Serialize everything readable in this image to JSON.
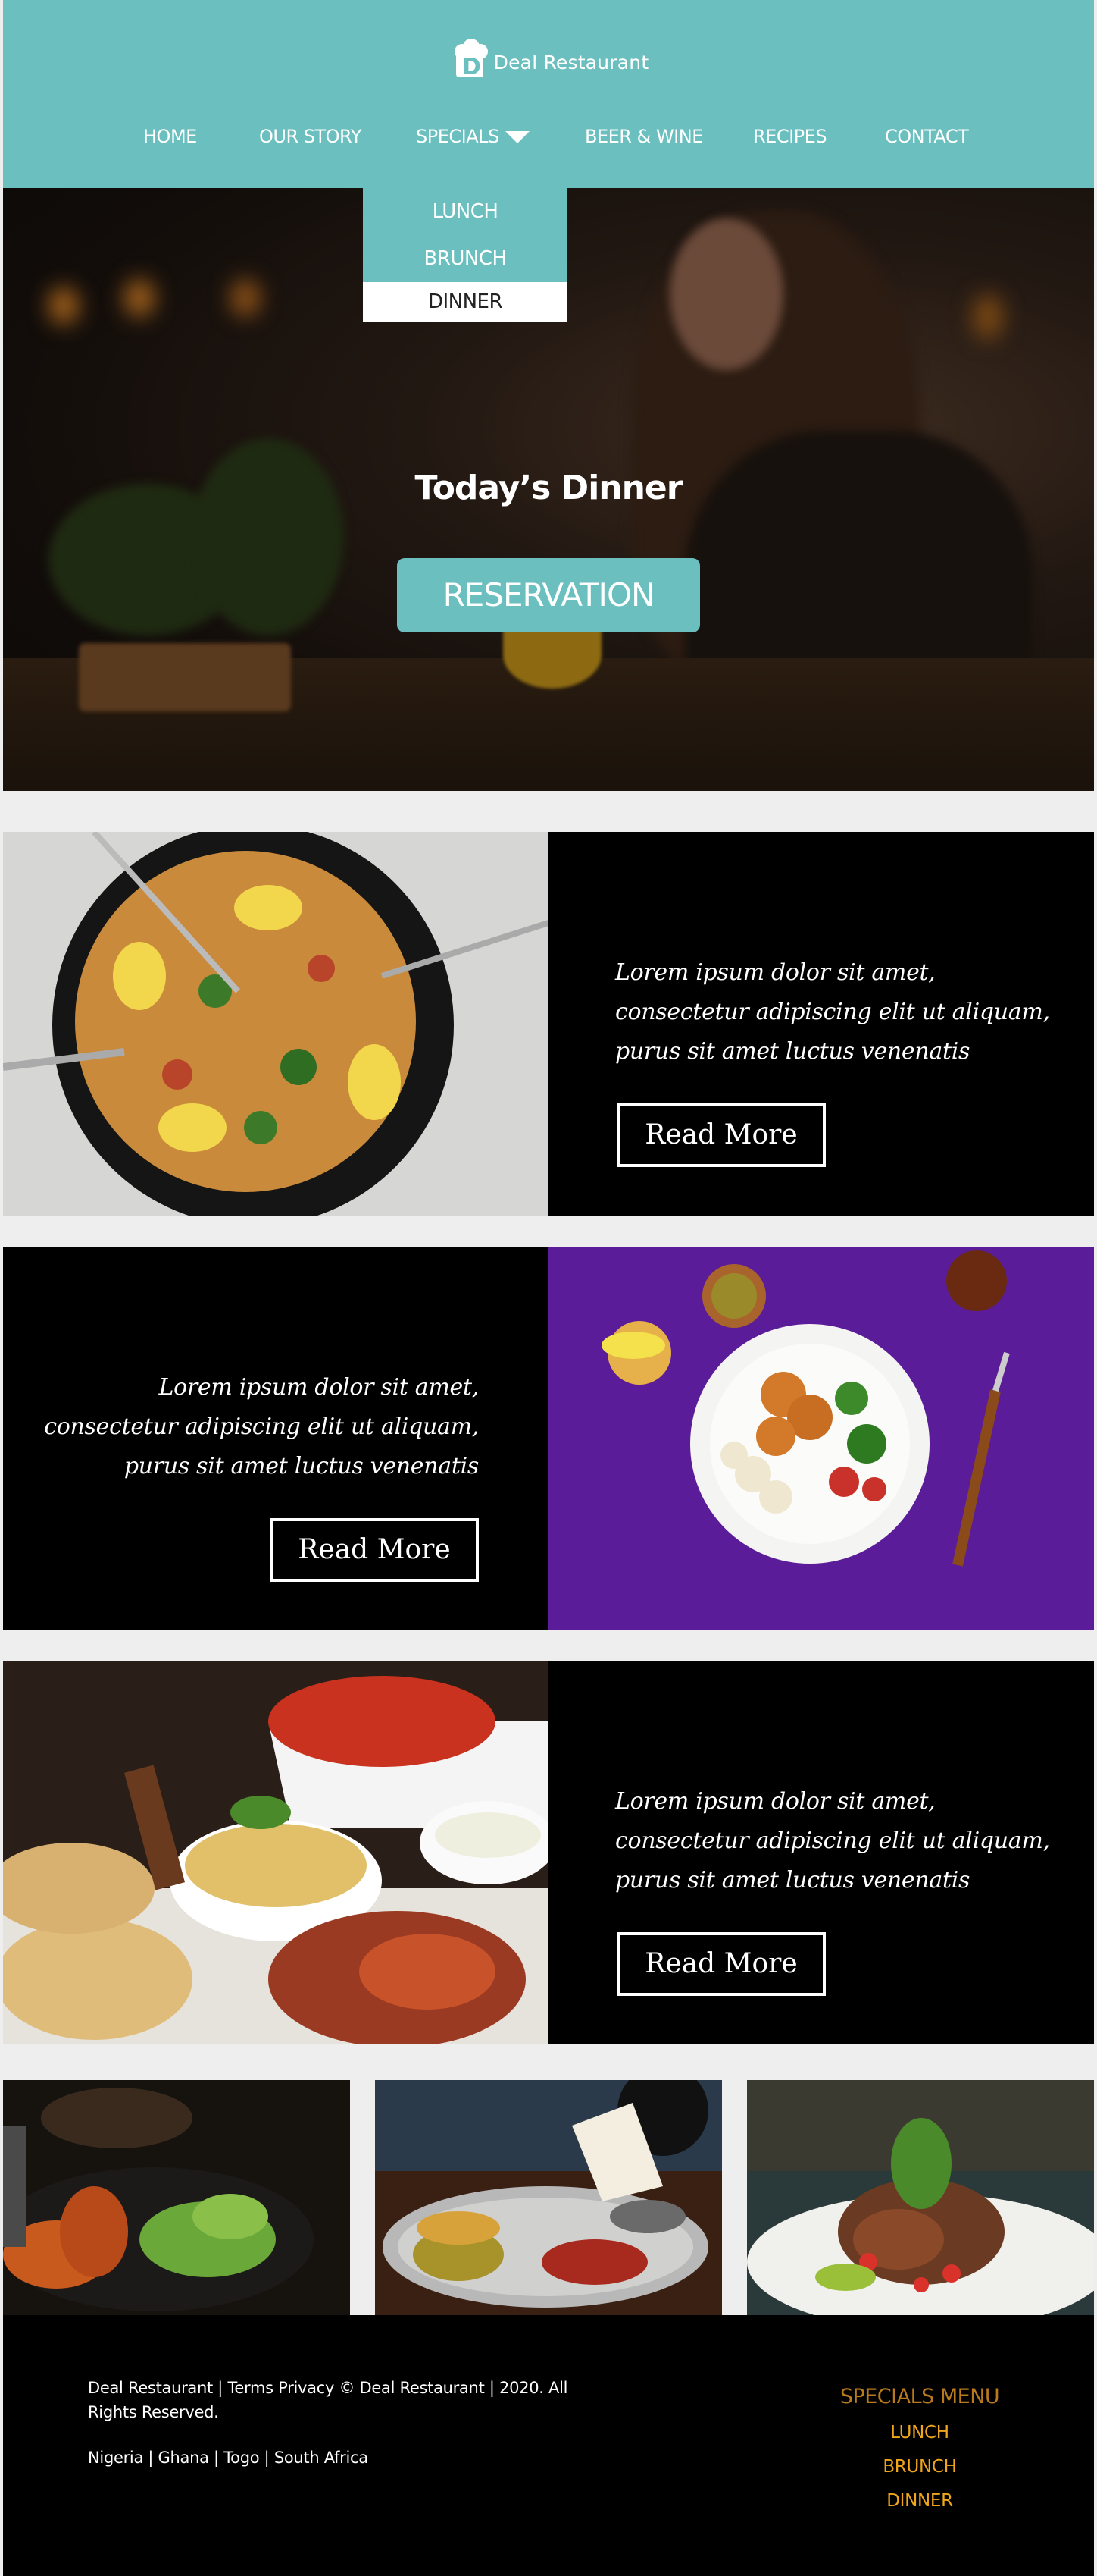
{
  "header": {
    "logo_text": "Deal Restaurant",
    "nav": [
      {
        "label": "HOME"
      },
      {
        "label": "OUR STORY"
      },
      {
        "label": "SPECIALS"
      },
      {
        "label": "BEER & WINE"
      },
      {
        "label": "RECIPES"
      },
      {
        "label": "CONTACT"
      }
    ],
    "specials_dropdown": [
      {
        "label": "LUNCH"
      },
      {
        "label": "BRUNCH"
      },
      {
        "label": "DINNER",
        "active": true
      }
    ]
  },
  "hero": {
    "title": "Today’s Dinner",
    "button_label": "RESERVATION"
  },
  "features": [
    {
      "text_lines": [
        "Lorem ipsum dolor sit amet,",
        "consectetur adipiscing elit ut aliquam,",
        "purus sit amet luctus venenatis"
      ],
      "button_label": "Read More"
    },
    {
      "text_lines": [
        "Lorem ipsum dolor sit amet,",
        "consectetur adipiscing elit ut aliquam,",
        "purus sit amet luctus venenatis"
      ],
      "button_label": "Read More"
    },
    {
      "text_lines": [
        "Lorem ipsum dolor sit amet,",
        "consectetur adipiscing elit ut aliquam,",
        "purus sit amet luctus venenatis"
      ],
      "button_label": "Read More"
    }
  ],
  "footer": {
    "copyright": "Deal Restaurant  | Terms Privacy © Deal Restaurant  |  2020. All Rights Reserved.",
    "countries": "Nigeria | Ghana | Togo | South Africa",
    "specials_title": "SPECIALS MENU",
    "specials_items": [
      "LUNCH",
      "BRUNCH",
      "DINNER"
    ]
  },
  "colors": {
    "teal": "#6bbfbf",
    "black": "#000000",
    "gold": "#f0a61c",
    "purple": "#5b1a9a"
  }
}
